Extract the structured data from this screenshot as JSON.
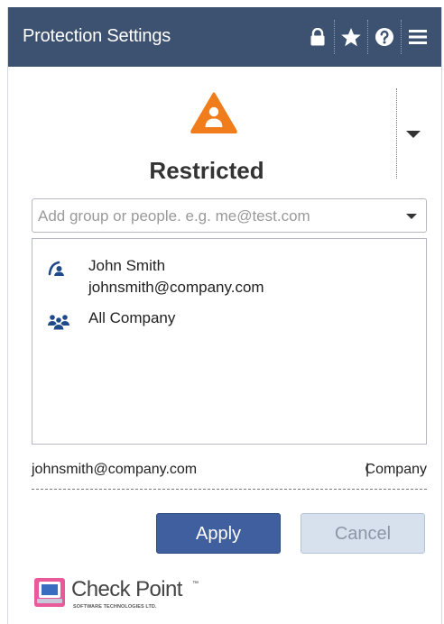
{
  "header": {
    "title": "Protection Settings",
    "icons": [
      "lock-icon",
      "star-icon",
      "help-icon",
      "menu-icon"
    ],
    "background": "#3c5270"
  },
  "classification": {
    "level_label": "Restricted",
    "icon": "warning-person-icon",
    "icon_color": "#f07c1b"
  },
  "add_people": {
    "placeholder": "Add group or people. e.g. me@test.com",
    "value": ""
  },
  "recipients": [
    {
      "icon": "user-icon",
      "name": "John Smith",
      "email": "johnsmith@company.com"
    },
    {
      "icon": "group-icon",
      "name": "All Company",
      "email": ""
    }
  ],
  "owner": {
    "email": "johnsmith@company.com",
    "separator": "|",
    "organization": "Company"
  },
  "buttons": {
    "apply": "Apply",
    "cancel": "Cancel",
    "apply_color": "#3f5f9e"
  },
  "brand": {
    "name": "Check Point",
    "trademark": "™",
    "tagline": "SOFTWARE TECHNOLOGIES LTD."
  }
}
